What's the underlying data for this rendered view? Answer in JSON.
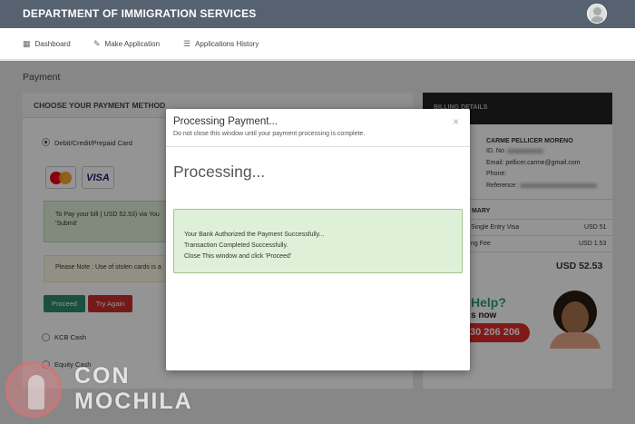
{
  "header": {
    "brand": "DEPARTMENT OF IMMIGRATION SERVICES"
  },
  "nav": {
    "items": [
      {
        "label": "Dashboard",
        "icon": "dashboard-icon"
      },
      {
        "label": "Make Application",
        "icon": "pencil-icon"
      },
      {
        "label": "Applications History",
        "icon": "list-icon"
      }
    ]
  },
  "page": {
    "title": "Payment"
  },
  "payment_panel": {
    "header": "CHOOSE YOUR PAYMENT METHOD",
    "options": [
      "Debit/Credit/Prepaid Card",
      "KCB Cash",
      "Equity Cash"
    ],
    "selected_option": "Debit/Credit/Prepaid Card",
    "card_brands": [
      "MasterCard",
      "VISA"
    ],
    "info_line1": "To Pay your bill ( USD 52.53) via You",
    "info_line2": "'Submit'",
    "note": "Please Note : Use of stolen cards is a",
    "proceed_label": "Proceed",
    "try_again_label": "Try Again"
  },
  "side_panel": {
    "header": "BILLING DETAILS",
    "name": "CARME PELLICER MORENO",
    "id_label": "ID. No",
    "email": "Email: pellicer.carme@gmail.com",
    "phone_label": "Phone:",
    "reference_label": "Reference:",
    "summary_header": "MARY",
    "line1_label": "Single Entry Visa",
    "line1_value": "USD 51",
    "line2_label": "ng Fee",
    "line2_value": "USD 1.53",
    "total": "USD 52.53",
    "help_title": "Help?",
    "help_sub": "s now",
    "help_phone": "30 206 206"
  },
  "modal": {
    "title": "Processing Payment...",
    "subtitle": "Do not close this window until your payment processing is complete.",
    "close_icon": "×",
    "status": "Processing...",
    "messages": [
      "Your Bank Authorized the Payment Successfully...",
      "Transaction Completed Successfully.",
      "Close This window and click 'Proceed'"
    ]
  },
  "watermark": {
    "line1": "CON",
    "line2": "MOCHILA"
  },
  "colors": {
    "topbar": "#566270",
    "success_bg": "#dff0d8",
    "proceed": "#2e8b6e",
    "try_again": "#c9302c",
    "help_green": "#2e9d6e",
    "phone_red": "#e02b2b"
  }
}
